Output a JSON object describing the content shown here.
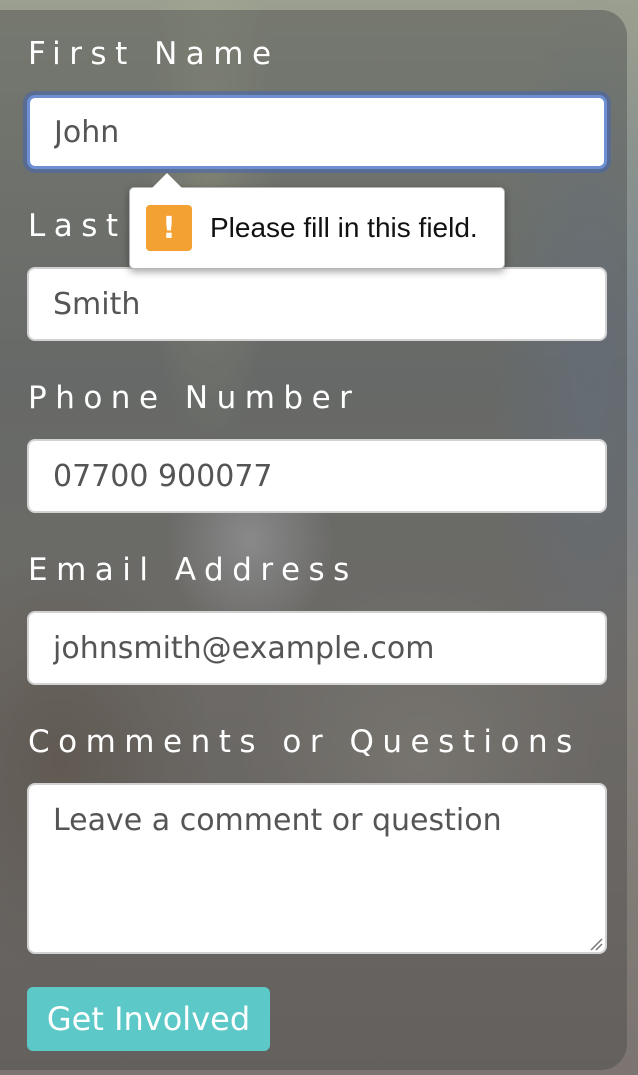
{
  "form": {
    "first_name": {
      "label": "First Name",
      "value": "John"
    },
    "last_name": {
      "label": "Last Name",
      "value": "Smith"
    },
    "phone": {
      "label": "Phone Number",
      "value": "07700 900077"
    },
    "email": {
      "label": "Email Address",
      "value": "johnsmith@example.com"
    },
    "comments": {
      "label": "Comments or Questions",
      "placeholder": "Leave a comment or question"
    },
    "submit_label": "Get Involved"
  },
  "validation_tooltip": {
    "icon": "warning-icon",
    "icon_glyph": "!",
    "message": "Please fill in this field."
  },
  "colors": {
    "accent_button": "#5cc8c8",
    "focus_ring": "#6e8fd3",
    "warning": "#f4a133"
  }
}
